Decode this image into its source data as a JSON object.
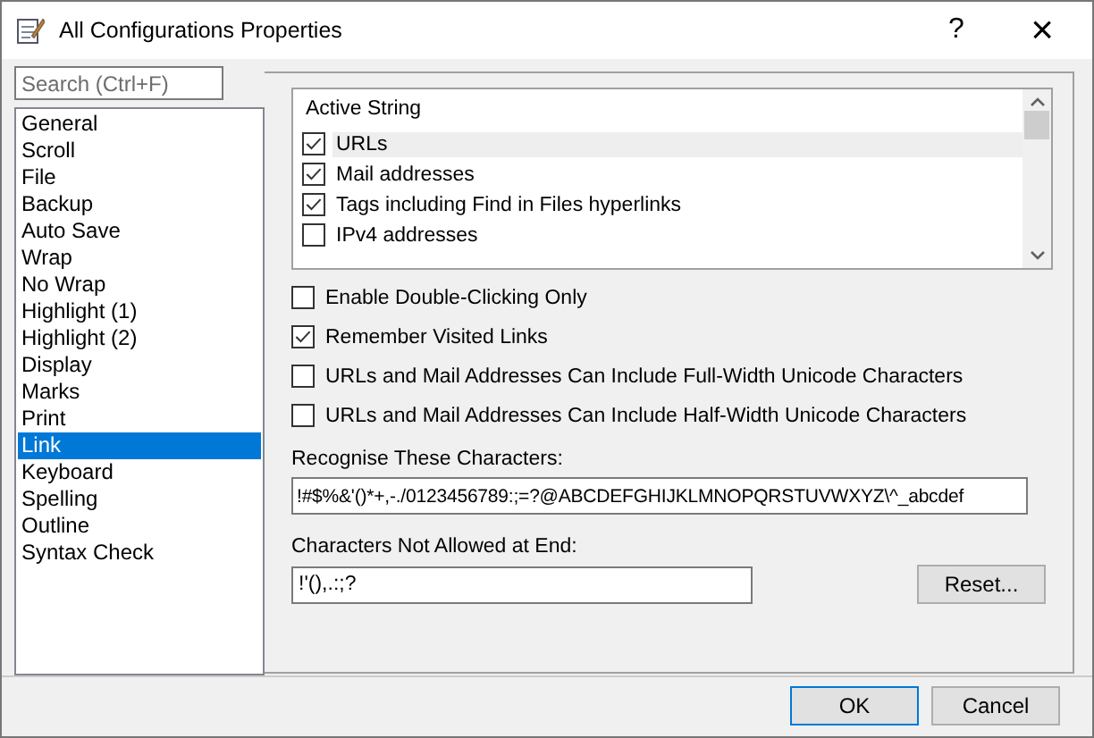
{
  "window": {
    "title": "All Configurations Properties",
    "help": "?",
    "close": "×"
  },
  "sidebar": {
    "search": {
      "placeholder": "Search (Ctrl+F)"
    },
    "items": [
      {
        "label": "General",
        "selected": false
      },
      {
        "label": "Scroll",
        "selected": false
      },
      {
        "label": "File",
        "selected": false
      },
      {
        "label": "Backup",
        "selected": false
      },
      {
        "label": "Auto Save",
        "selected": false
      },
      {
        "label": "Wrap",
        "selected": false
      },
      {
        "label": "No Wrap",
        "selected": false
      },
      {
        "label": "Highlight (1)",
        "selected": false
      },
      {
        "label": "Highlight (2)",
        "selected": false
      },
      {
        "label": "Display",
        "selected": false
      },
      {
        "label": "Marks",
        "selected": false
      },
      {
        "label": "Print",
        "selected": false
      },
      {
        "label": "Link",
        "selected": true
      },
      {
        "label": "Keyboard",
        "selected": false
      },
      {
        "label": "Spelling",
        "selected": false
      },
      {
        "label": "Outline",
        "selected": false
      },
      {
        "label": "Syntax Check",
        "selected": false
      }
    ]
  },
  "active_string": {
    "heading": "Active String",
    "items": [
      {
        "label": "URLs",
        "checked": true,
        "selected": true
      },
      {
        "label": "Mail addresses",
        "checked": true,
        "selected": false
      },
      {
        "label": "Tags including Find in Files hyperlinks",
        "checked": true,
        "selected": false
      },
      {
        "label": "IPv4 addresses",
        "checked": false,
        "selected": false
      }
    ]
  },
  "options": [
    {
      "label": "Enable Double-Clicking Only",
      "checked": false
    },
    {
      "label": "Remember Visited Links",
      "checked": true
    },
    {
      "label": "URLs and Mail Addresses Can Include Full-Width Unicode Characters",
      "checked": false
    },
    {
      "label": "URLs and Mail Addresses Can Include Half-Width Unicode Characters",
      "checked": false
    }
  ],
  "recognise": {
    "label": "Recognise These Characters:",
    "value": "!#$%&'()*+,-./0123456789:;=?@ABCDEFGHIJKLMNOPQRSTUVWXYZ\\^_abcdef"
  },
  "not_allowed": {
    "label": "Characters Not Allowed at End:",
    "value": "!'(),.:;?"
  },
  "reset_button": "Reset...",
  "buttons": [
    "OK",
    "Cancel"
  ]
}
